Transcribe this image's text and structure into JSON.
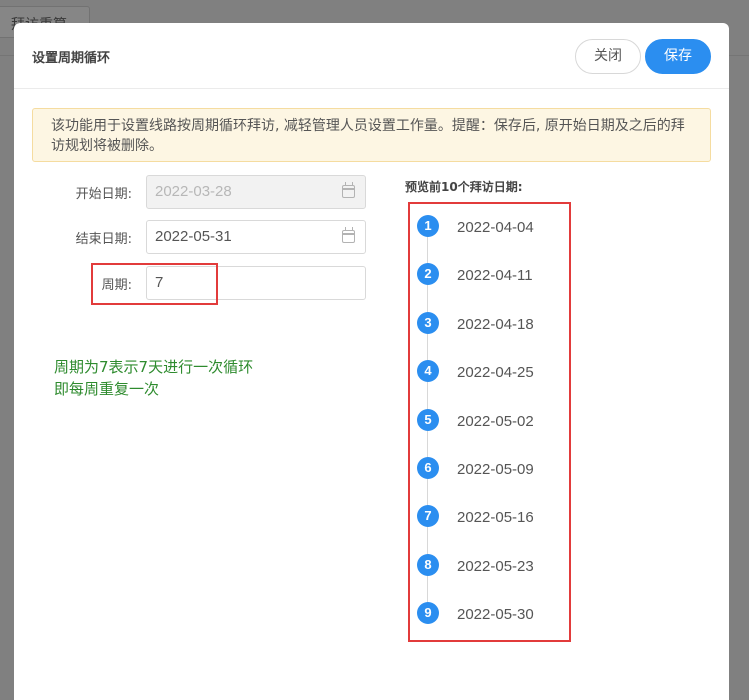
{
  "background": {
    "tab_label": "拜访重算"
  },
  "modal": {
    "title": "设置周期循环",
    "close_label": "关闭",
    "save_label": "保存",
    "notice": "该功能用于设置线路按周期循环拜访, 减轻管理人员设置工作量。提醒：保存后, 原开始日期及之后的拜访规划将被删除。",
    "form": {
      "start_label": "开始日期:",
      "start_value": "2022-03-28",
      "end_label": "结束日期:",
      "end_value": "2022-05-31",
      "period_label": "周期:",
      "period_value": "7"
    },
    "hint_lines": [
      "周期为7表示7天进行一次循环",
      "即每周重复一次"
    ],
    "preview_title": "预览前10个拜访日期:",
    "preview_items": [
      {
        "index": "1",
        "date": "2022-04-04"
      },
      {
        "index": "2",
        "date": "2022-04-11"
      },
      {
        "index": "3",
        "date": "2022-04-18"
      },
      {
        "index": "4",
        "date": "2022-04-25"
      },
      {
        "index": "5",
        "date": "2022-05-02"
      },
      {
        "index": "6",
        "date": "2022-05-09"
      },
      {
        "index": "7",
        "date": "2022-05-16"
      },
      {
        "index": "8",
        "date": "2022-05-23"
      },
      {
        "index": "9",
        "date": "2022-05-30"
      }
    ]
  },
  "colors": {
    "accent": "#2b8ef0",
    "annotation_red": "#e23b3b",
    "hint_green": "#2e8b2e",
    "notice_bg": "#fdf6e3"
  }
}
